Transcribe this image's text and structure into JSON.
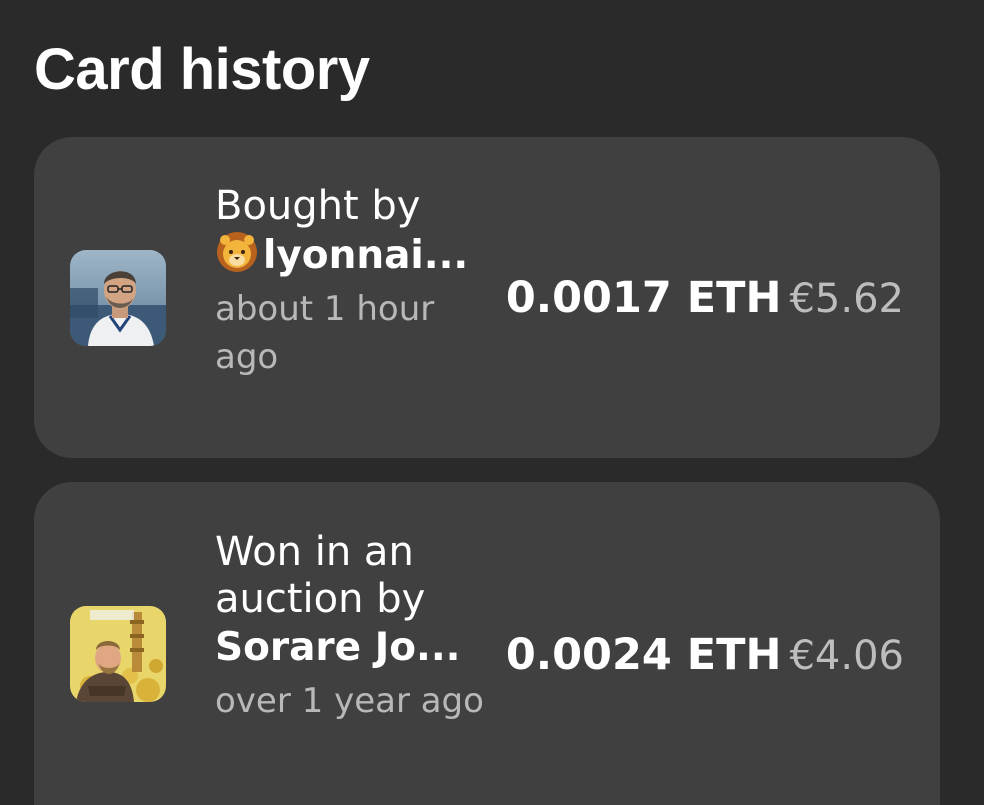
{
  "page": {
    "title": "Card history"
  },
  "history": [
    {
      "action": "Bought by",
      "user_icon": "lion-emoji",
      "user": "lyonnai...",
      "time": "about 1 hour ago",
      "eth": "0.0017 ETH",
      "eur": "€5.62"
    },
    {
      "action": "Won in an auction by",
      "user": "Sorare Jo...",
      "time": "over 1 year ago",
      "eth": "0.0024 ETH",
      "eur": "€4.06"
    }
  ],
  "colors": {
    "background": "#2a2a2a",
    "card": "#404040",
    "muted_text": "#b8b8b8"
  }
}
